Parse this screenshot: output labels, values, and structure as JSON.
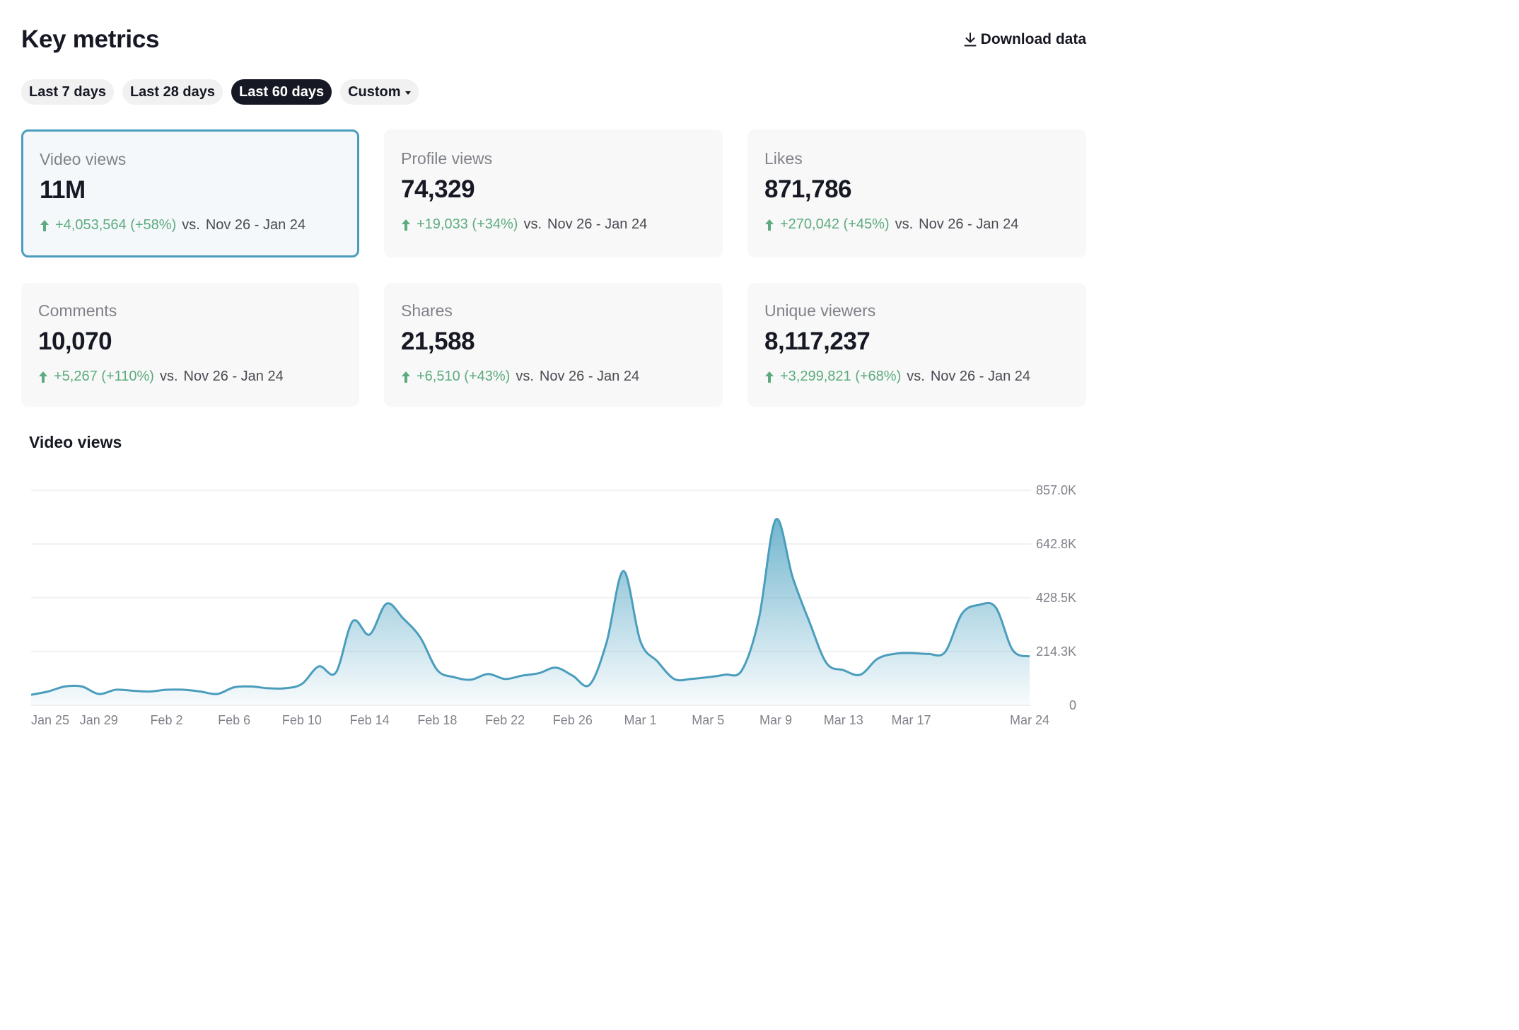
{
  "header": {
    "title": "Key metrics",
    "download_label": "Download data"
  },
  "ranges": [
    {
      "label": "Last 7 days",
      "active": false
    },
    {
      "label": "Last 28 days",
      "active": false
    },
    {
      "label": "Last 60 days",
      "active": true
    },
    {
      "label": "Custom",
      "active": false
    }
  ],
  "metrics": [
    {
      "label": "Video views",
      "value": "11M",
      "change": "+4,053,564 (+58%)",
      "vs": "vs.",
      "period": "Nov 26 - Jan 24"
    },
    {
      "label": "Profile views",
      "value": "74,329",
      "change": "+19,033 (+34%)",
      "vs": "vs.",
      "period": "Nov 26 - Jan 24"
    },
    {
      "label": "Likes",
      "value": "871,786",
      "change": "+270,042 (+45%)",
      "vs": "vs.",
      "period": "Nov 26 - Jan 24"
    },
    {
      "label": "Comments",
      "value": "10,070",
      "change": "+5,267 (+110%)",
      "vs": "vs.",
      "period": "Nov 26 - Jan 24"
    },
    {
      "label": "Shares",
      "value": "21,588",
      "change": "+6,510 (+43%)",
      "vs": "vs.",
      "period": "Nov 26 - Jan 24"
    },
    {
      "label": "Unique viewers",
      "value": "8,117,237",
      "change": "+3,299,821 (+68%)",
      "vs": "vs.",
      "period": "Nov 26 - Jan 24"
    }
  ],
  "colors": {
    "accent": "#4a9dbd",
    "positive": "#5cab7e",
    "line": "#4a9dbd",
    "text": "#161823"
  },
  "chart_data": {
    "type": "area",
    "title": "Video views",
    "y_ticks": [
      "0",
      "214.3K",
      "428.5K",
      "642.8K",
      "857.0K"
    ],
    "ylim": [
      0,
      857000
    ],
    "x_ticks": [
      {
        "label": "Jan 25",
        "day": 0
      },
      {
        "label": "Jan 29",
        "day": 4
      },
      {
        "label": "Feb 2",
        "day": 8
      },
      {
        "label": "Feb 6",
        "day": 12
      },
      {
        "label": "Feb 10",
        "day": 16
      },
      {
        "label": "Feb 14",
        "day": 20
      },
      {
        "label": "Feb 18",
        "day": 24
      },
      {
        "label": "Feb 22",
        "day": 28
      },
      {
        "label": "Feb 26",
        "day": 32
      },
      {
        "label": "Mar 1",
        "day": 36
      },
      {
        "label": "Mar 5",
        "day": 40
      },
      {
        "label": "Mar 9",
        "day": 44
      },
      {
        "label": "Mar 13",
        "day": 48
      },
      {
        "label": "Mar 17",
        "day": 52
      },
      {
        "label": "Mar 24",
        "day": 59
      }
    ],
    "x": [
      "Jan 25",
      "Jan 26",
      "Jan 27",
      "Jan 28",
      "Jan 29",
      "Jan 30",
      "Jan 31",
      "Feb 1",
      "Feb 2",
      "Feb 3",
      "Feb 4",
      "Feb 5",
      "Feb 6",
      "Feb 7",
      "Feb 8",
      "Feb 9",
      "Feb 10",
      "Feb 11",
      "Feb 12",
      "Feb 13",
      "Feb 14",
      "Feb 15",
      "Feb 16",
      "Feb 17",
      "Feb 18",
      "Feb 19",
      "Feb 20",
      "Feb 21",
      "Feb 22",
      "Feb 23",
      "Feb 24",
      "Feb 25",
      "Feb 26",
      "Feb 27",
      "Feb 28",
      "Feb 29",
      "Mar 1",
      "Mar 2",
      "Mar 3",
      "Mar 4",
      "Mar 5",
      "Mar 6",
      "Mar 7",
      "Mar 8",
      "Mar 9",
      "Mar 10",
      "Mar 11",
      "Mar 12",
      "Mar 13",
      "Mar 14",
      "Mar 15",
      "Mar 16",
      "Mar 17",
      "Mar 18",
      "Mar 19",
      "Mar 20",
      "Mar 21",
      "Mar 22",
      "Mar 23",
      "Mar 24"
    ],
    "values": [
      42000,
      55000,
      75000,
      75000,
      45000,
      62000,
      58000,
      55000,
      62000,
      62000,
      55000,
      45000,
      72000,
      75000,
      68000,
      68000,
      85000,
      155000,
      130000,
      335000,
      282000,
      405000,
      345000,
      270000,
      140000,
      112000,
      102000,
      125000,
      105000,
      118000,
      128000,
      150000,
      118000,
      82000,
      250000,
      535000,
      255000,
      175000,
      105000,
      105000,
      112000,
      122000,
      140000,
      345000,
      740000,
      510000,
      330000,
      168000,
      140000,
      122000,
      185000,
      205000,
      208000,
      205000,
      212000,
      365000,
      400000,
      390000,
      220000,
      195000
    ]
  }
}
